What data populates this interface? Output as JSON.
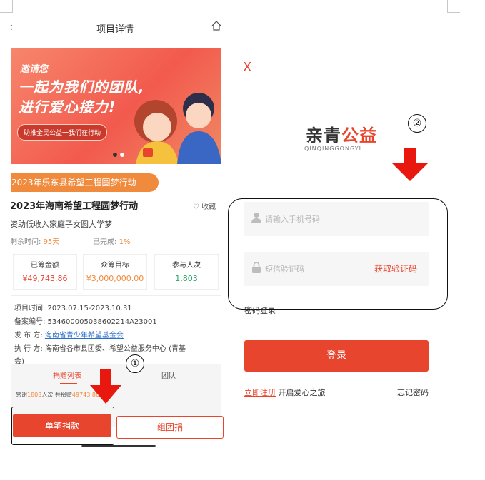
{
  "left": {
    "topbar": {
      "back_icon": "chevron-left",
      "title": "项目详情",
      "home_icon": "home-icon"
    },
    "banner": {
      "invite": "邀请您",
      "line1": "一起为我们的团队,",
      "line2": "进行爱心接力!",
      "pill": "助推全民公益一我们在行动"
    },
    "tag": "2023年乐东县希望工程圆梦行动",
    "project_title": "2023年海南希望工程圆梦行动",
    "favorite": "收藏",
    "description": "资助低收入家庭子女圆大学梦",
    "remaining_label": "剩余时间:",
    "remaining_value": "95天",
    "completed_label": "已完成:",
    "completed_value": "1%",
    "stats": [
      {
        "label": "已筹金额",
        "value": "¥49,743.86",
        "color": "#e8452e"
      },
      {
        "label": "众筹目标",
        "value": "¥3,000,000.00",
        "color": "#f08a3c"
      },
      {
        "label": "参与人次",
        "value": "1,803",
        "color": "#2aa56a"
      }
    ],
    "info": {
      "time": "项目时间: 2023.07.15-2023.10.31",
      "record": "备案编号: 534600005038602214A23001",
      "publisher_label": "发 布 方: ",
      "publisher": "海南省青少年希望基金会",
      "executor_line1": "执 行 方: 海南省各市县团委、希望公益服务中心 (青基",
      "executor_line2": "会)"
    },
    "tabs": {
      "donations": "捐赠列表",
      "team": "团队"
    },
    "thanks": {
      "prefix": "感谢",
      "count": "1803",
      "mid": "人次 共捐赠",
      "amount": "49743.86",
      "suffix": "元"
    },
    "buttons": {
      "single": "单笔捐款",
      "group": "组团捐"
    },
    "annotation_number": "①"
  },
  "right": {
    "close": "X",
    "logo_cn_black": "亲青",
    "logo_cn_red": "公益",
    "logo_en": "QINQINGGONGYI",
    "phone_placeholder": "请输入手机号码",
    "code_placeholder": "短信验证码",
    "get_code": "获取验证码",
    "password_login": "密码登录",
    "login": "登录",
    "register": "立即注册",
    "register_tail": " 开启爱心之旅",
    "forgot": "忘记密码",
    "annotation_number": "②"
  },
  "colors": {
    "brand_red": "#e8452e",
    "orange": "#f08a3c",
    "arrow_red": "#e8180f"
  }
}
